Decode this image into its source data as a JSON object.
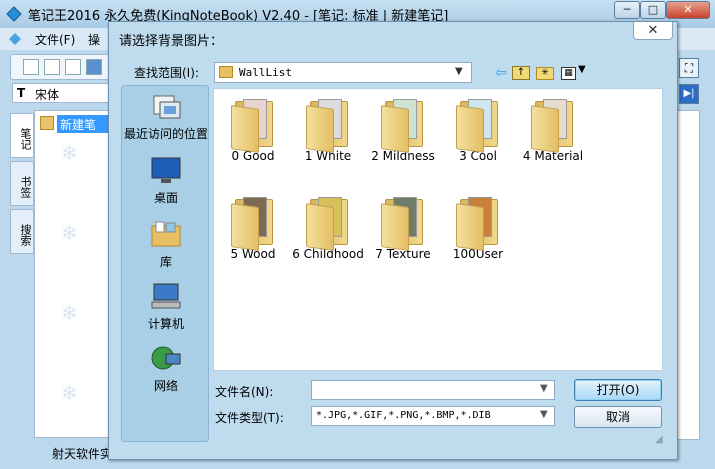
{
  "main": {
    "title": "笔记王2016 永久免费(KingNoteBook) V2.40 - [笔记: 标准 | 新建笔记]",
    "min_glyph": "─",
    "max_glyph": "□",
    "close_glyph": "✕",
    "menu": [
      "文件(F)",
      "操"
    ],
    "font_name": "宋体",
    "font_icon": "T",
    "tabs": [
      "笔记",
      "书签",
      "搜索"
    ],
    "tree_item": "新建笔",
    "status": "射天软件实"
  },
  "dialog": {
    "title": "请选择背景图片：",
    "close_glyph": "✕",
    "look_in_label": "查找范围(I):",
    "look_in_value": "WallList",
    "places": [
      {
        "label": "最近访问的位置",
        "icon": "recent-places-icon"
      },
      {
        "label": "桌面",
        "icon": "desktop-icon"
      },
      {
        "label": "库",
        "icon": "libraries-icon"
      },
      {
        "label": "计算机",
        "icon": "computer-icon"
      },
      {
        "label": "网络",
        "icon": "network-icon"
      }
    ],
    "folders": [
      {
        "name": "0 Good",
        "preview": "#e8d3cf"
      },
      {
        "name": "1 White",
        "preview": "#dcdcdc"
      },
      {
        "name": "2 Mildness",
        "preview": "#cfe3d5"
      },
      {
        "name": "3 Cool",
        "preview": "#d0e6ef"
      },
      {
        "name": "4 Material",
        "preview": "#e6dccd"
      },
      {
        "name": "5 Wood",
        "preview": "#7d6a55"
      },
      {
        "name": "6 Childhood",
        "preview": "#d6c15a"
      },
      {
        "name": "7 Texture",
        "preview": "#6f7d6a"
      },
      {
        "name": "100User",
        "preview": "#c8803a"
      }
    ],
    "filename_label": "文件名(N):",
    "filename_value": "",
    "filetype_label": "文件类型(T):",
    "filetype_value": "*.JPG,*.GIF,*.PNG,*.BMP,*.DIB",
    "open_label": "打开(O)",
    "cancel_label": "取消"
  },
  "colors": {
    "accent": "#3399ff",
    "dialog_bg": "#bfdcef",
    "folder": "#e8c063"
  }
}
